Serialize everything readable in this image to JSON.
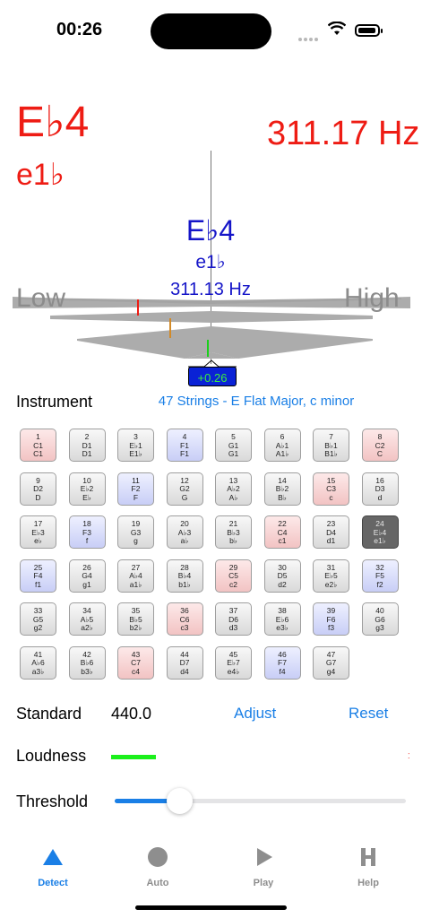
{
  "status": {
    "time": "00:26"
  },
  "tuner": {
    "note": "E♭4",
    "note_alt": "e1♭",
    "frequency": "311.17 Hz",
    "center_note": "E♭4",
    "center_note_alt": "e1♭",
    "center_frequency": "311.13 Hz",
    "low_label": "Low",
    "high_label": "High",
    "cents": "+0.26",
    "colors": {
      "detected": "#ee1c14",
      "target": "#1515c8",
      "meter": "#acacac"
    }
  },
  "instrument": {
    "label": "Instrument",
    "value": "47 Strings - E Flat Major, c minor"
  },
  "strings": [
    {
      "n": "1",
      "a": "C1",
      "b": "C1",
      "c": "r"
    },
    {
      "n": "2",
      "a": "D1",
      "b": "D1",
      "c": "w"
    },
    {
      "n": "3",
      "a": "E♭1",
      "b": "E1♭",
      "c": "w"
    },
    {
      "n": "4",
      "a": "F1",
      "b": "F1",
      "c": "b"
    },
    {
      "n": "5",
      "a": "G1",
      "b": "G1",
      "c": "w"
    },
    {
      "n": "6",
      "a": "A♭1",
      "b": "A1♭",
      "c": "w"
    },
    {
      "n": "7",
      "a": "B♭1",
      "b": "B1♭",
      "c": "w"
    },
    {
      "n": "8",
      "a": "C2",
      "b": "C",
      "c": "r"
    },
    {
      "n": "9",
      "a": "D2",
      "b": "D",
      "c": "w"
    },
    {
      "n": "10",
      "a": "E♭2",
      "b": "E♭",
      "c": "w"
    },
    {
      "n": "11",
      "a": "F2",
      "b": "F",
      "c": "b"
    },
    {
      "n": "12",
      "a": "G2",
      "b": "G",
      "c": "w"
    },
    {
      "n": "13",
      "a": "A♭2",
      "b": "A♭",
      "c": "w"
    },
    {
      "n": "14",
      "a": "B♭2",
      "b": "B♭",
      "c": "w"
    },
    {
      "n": "15",
      "a": "C3",
      "b": "c",
      "c": "r"
    },
    {
      "n": "16",
      "a": "D3",
      "b": "d",
      "c": "w"
    },
    {
      "n": "17",
      "a": "E♭3",
      "b": "e♭",
      "c": "w"
    },
    {
      "n": "18",
      "a": "F3",
      "b": "f",
      "c": "b"
    },
    {
      "n": "19",
      "a": "G3",
      "b": "g",
      "c": "w"
    },
    {
      "n": "20",
      "a": "A♭3",
      "b": "a♭",
      "c": "w"
    },
    {
      "n": "21",
      "a": "B♭3",
      "b": "b♭",
      "c": "w"
    },
    {
      "n": "22",
      "a": "C4",
      "b": "c1",
      "c": "r"
    },
    {
      "n": "23",
      "a": "D4",
      "b": "d1",
      "c": "w"
    },
    {
      "n": "24",
      "a": "E♭4",
      "b": "e1♭",
      "c": "sel"
    },
    {
      "n": "25",
      "a": "F4",
      "b": "f1",
      "c": "b"
    },
    {
      "n": "26",
      "a": "G4",
      "b": "g1",
      "c": "w"
    },
    {
      "n": "27",
      "a": "A♭4",
      "b": "a1♭",
      "c": "w"
    },
    {
      "n": "28",
      "a": "B♭4",
      "b": "b1♭",
      "c": "w"
    },
    {
      "n": "29",
      "a": "C5",
      "b": "c2",
      "c": "r"
    },
    {
      "n": "30",
      "a": "D5",
      "b": "d2",
      "c": "w"
    },
    {
      "n": "31",
      "a": "E♭5",
      "b": "e2♭",
      "c": "w"
    },
    {
      "n": "32",
      "a": "F5",
      "b": "f2",
      "c": "b"
    },
    {
      "n": "33",
      "a": "G5",
      "b": "g2",
      "c": "w"
    },
    {
      "n": "34",
      "a": "A♭5",
      "b": "a2♭",
      "c": "w"
    },
    {
      "n": "35",
      "a": "B♭5",
      "b": "b2♭",
      "c": "w"
    },
    {
      "n": "36",
      "a": "C6",
      "b": "c3",
      "c": "r"
    },
    {
      "n": "37",
      "a": "D6",
      "b": "d3",
      "c": "w"
    },
    {
      "n": "38",
      "a": "E♭6",
      "b": "e3♭",
      "c": "w"
    },
    {
      "n": "39",
      "a": "F6",
      "b": "f3",
      "c": "b"
    },
    {
      "n": "40",
      "a": "G6",
      "b": "g3",
      "c": "w"
    },
    {
      "n": "41",
      "a": "A♭6",
      "b": "a3♭",
      "c": "w"
    },
    {
      "n": "42",
      "a": "B♭6",
      "b": "b3♭",
      "c": "w"
    },
    {
      "n": "43",
      "a": "C7",
      "b": "c4",
      "c": "r"
    },
    {
      "n": "44",
      "a": "D7",
      "b": "d4",
      "c": "w"
    },
    {
      "n": "45",
      "a": "E♭7",
      "b": "e4♭",
      "c": "w"
    },
    {
      "n": "46",
      "a": "F7",
      "b": "f4",
      "c": "b"
    },
    {
      "n": "47",
      "a": "G7",
      "b": "g4",
      "c": "w"
    }
  ],
  "standard": {
    "label": "Standard",
    "value": "440.0",
    "adjust_label": "Adjust",
    "reset_label": "Reset"
  },
  "loudness": {
    "label": "Loudness",
    "level": 0.15,
    "color": "#1bf01b"
  },
  "threshold": {
    "label": "Threshold",
    "level": 0.22,
    "color": "#1a7fe6"
  },
  "tabs": [
    {
      "label": "Detect",
      "icon": "triangle-icon",
      "active": true
    },
    {
      "label": "Auto",
      "icon": "circle-icon",
      "active": false
    },
    {
      "label": "Play",
      "icon": "play-icon",
      "active": false
    },
    {
      "label": "Help",
      "icon": "help-h-icon",
      "active": false
    }
  ],
  "accent_color": "#1a7fe6"
}
